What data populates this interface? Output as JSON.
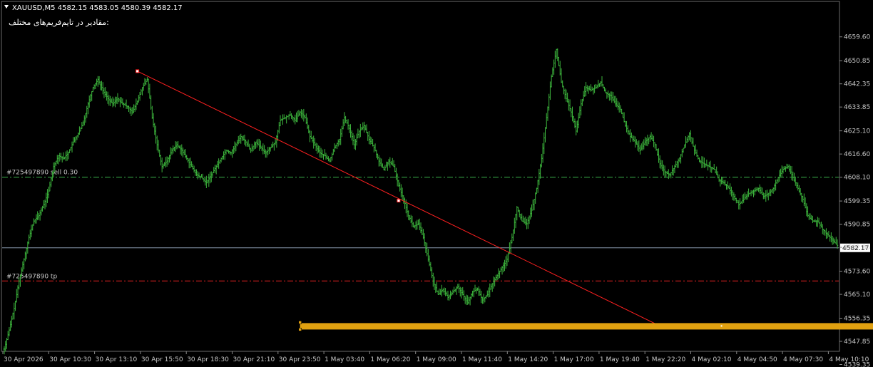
{
  "header": {
    "symbol_line": "XAUUSD,M5  4582.15 4583.05 4580.39 4582.17",
    "note": "مقادیر در تایم‌فریم‌های مختلف:"
  },
  "orders": [
    {
      "label": "#725497890 sell 0.30",
      "price": 4608.1,
      "color": "#3cb44b"
    },
    {
      "label": "#725497890 tp",
      "price": 4570.0,
      "color": "#e02020"
    }
  ],
  "current_price": {
    "value": 4582.17,
    "label": "4582.17",
    "line_color": "#8a9bb0"
  },
  "colors": {
    "background": "#000000",
    "bars": "#3cb43c",
    "trendline": "#ff2020",
    "zone": "#e0a010",
    "axis_text": "#c8c8c8"
  },
  "chart_data": {
    "type": "line",
    "title": "XAUUSD,M5",
    "ylim": [
      4537.0,
      4664.0
    ],
    "y_ticks": [
      "4659.60",
      "4650.85",
      "4642.35",
      "4633.85",
      "4625.10",
      "4616.60",
      "4608.10",
      "4599.35",
      "4590.85",
      "4582.35",
      "4573.60",
      "4565.10",
      "4556.35",
      "4547.85",
      "4539.35"
    ],
    "x_ticks": [
      "30 Apr 2026",
      "30 Apr 10:30",
      "30 Apr 13:10",
      "30 Apr 15:50",
      "30 Apr 18:30",
      "30 Apr 21:10",
      "30 Apr 23:50",
      "1 May 03:40",
      "1 May 06:20",
      "1 May 09:00",
      "1 May 11:40",
      "1 May 14:20",
      "1 May 17:00",
      "1 May 19:40",
      "1 May 22:20",
      "4 May 02:10",
      "4 May 04:50",
      "4 May 07:30",
      "4 May 10:10"
    ],
    "series": [
      {
        "values": [
          4545,
          4552,
          4560,
          4570,
          4578,
          4586,
          4592,
          4594,
          4598,
          4603,
          4612,
          4616,
          4615,
          4617,
          4621,
          4624,
          4628,
          4635,
          4641,
          4644,
          4640,
          4637,
          4635,
          4637,
          4635,
          4634,
          4632,
          4636,
          4641,
          4644,
          4630,
          4620,
          4612,
          4614,
          4618,
          4620,
          4618,
          4615,
          4612,
          4609,
          4608,
          4606,
          4609,
          4612,
          4615,
          4618,
          4617,
          4620,
          4623,
          4621,
          4618,
          4621,
          4619,
          4617,
          4619,
          4621,
          4629,
          4630,
          4631,
          4629,
          4632,
          4630,
          4623,
          4620,
          4617,
          4616,
          4614,
          4619,
          4622,
          4630,
          4626,
          4620,
          4625,
          4627,
          4622,
          4619,
          4614,
          4611,
          4614,
          4612,
          4605,
          4600,
          4594,
          4590,
          4591,
          4586,
          4578,
          4570,
          4565,
          4567,
          4564,
          4566,
          4568,
          4565,
          4562,
          4566,
          4567,
          4563,
          4565,
          4569,
          4572,
          4575,
          4578,
          4586,
          4597,
          4592,
          4591,
          4596,
          4604,
          4615,
          4630,
          4645,
          4655,
          4643,
          4637,
          4632,
          4625,
          4635,
          4641,
          4640,
          4641,
          4643,
          4639,
          4638,
          4635,
          4633,
          4627,
          4623,
          4621,
          4618,
          4621,
          4623,
          4620,
          4613,
          4610,
          4609,
          4612,
          4615,
          4620,
          4624,
          4618,
          4614,
          4613,
          4612,
          4611,
          4607,
          4606,
          4604,
          4601,
          4598,
          4600,
          4602,
          4603,
          4604,
          4601,
          4602,
          4604,
          4608,
          4611,
          4612,
          4608,
          4604,
          4600,
          4594,
          4592,
          4592,
          4589,
          4587,
          4585,
          4583
        ]
      }
    ],
    "trendline": {
      "from": {
        "x": 27,
        "y": 4647.0
      },
      "mid": {
        "x": 80,
        "y": 4599.5
      },
      "to": {
        "x": 133,
        "y": 4553.5
      }
    },
    "zone": {
      "x_from": 60,
      "x_to": 231,
      "y": 4553.5
    }
  }
}
